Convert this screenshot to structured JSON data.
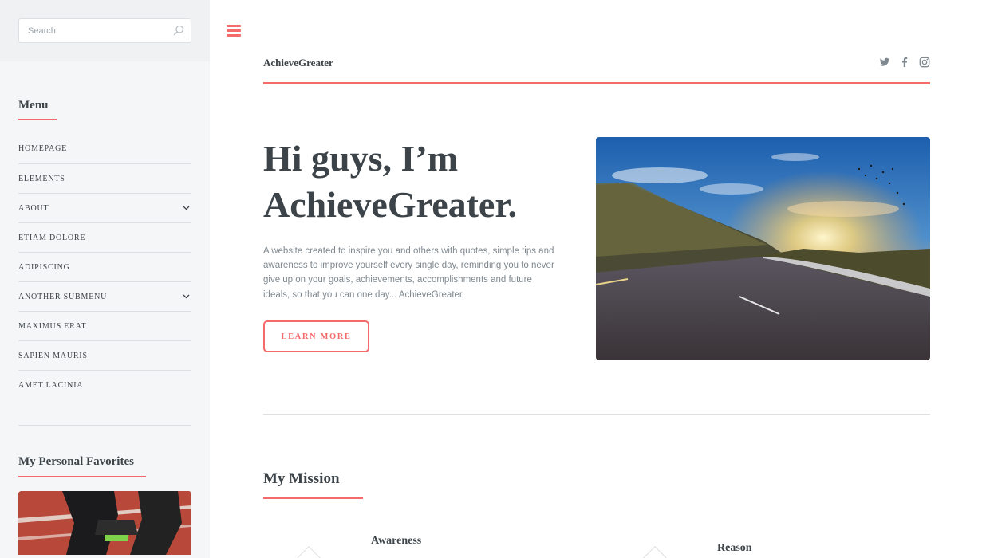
{
  "sidebar": {
    "search": {
      "placeholder": "Search",
      "value": ""
    },
    "menu_title": "Menu",
    "menu_items": [
      {
        "label": "HOMEPAGE",
        "has_submenu": false
      },
      {
        "label": "ELEMENTS",
        "has_submenu": false
      },
      {
        "label": "ABOUT",
        "has_submenu": true
      },
      {
        "label": "ETIAM DOLORE",
        "has_submenu": false
      },
      {
        "label": "ADIPISCING",
        "has_submenu": false
      },
      {
        "label": "ANOTHER SUBMENU",
        "has_submenu": true
      },
      {
        "label": "MAXIMUS ERAT",
        "has_submenu": false
      },
      {
        "label": "SAPIEN MAURIS",
        "has_submenu": false
      },
      {
        "label": "AMET LACINIA",
        "has_submenu": false
      }
    ],
    "favorites_title": "My Personal Favorites"
  },
  "header": {
    "logo": "AchieveGreater",
    "social_icons": [
      "twitter-icon",
      "facebook-icon",
      "instagram-icon"
    ]
  },
  "hero": {
    "title_line1": "Hi guys, I’m",
    "title_line2": "AchieveGreater.",
    "text": "A website created to inspire you and others with quotes, simple tips and awareness to improve yourself every single day, reminding you to never give up on your goals, achievements, accomplishments and future ideals, so that you can one day... AchieveGreater.",
    "button_label": "LEARN MORE"
  },
  "mission": {
    "title": "My Mission",
    "features": [
      {
        "title": "Awareness"
      },
      {
        "title": "Reason"
      }
    ]
  },
  "colors": {
    "accent": "#f56a6a",
    "text": "#3d4449",
    "muted": "#7f888f",
    "sidebar_bg": "#f5f6f7",
    "border": "#dde0e3"
  }
}
